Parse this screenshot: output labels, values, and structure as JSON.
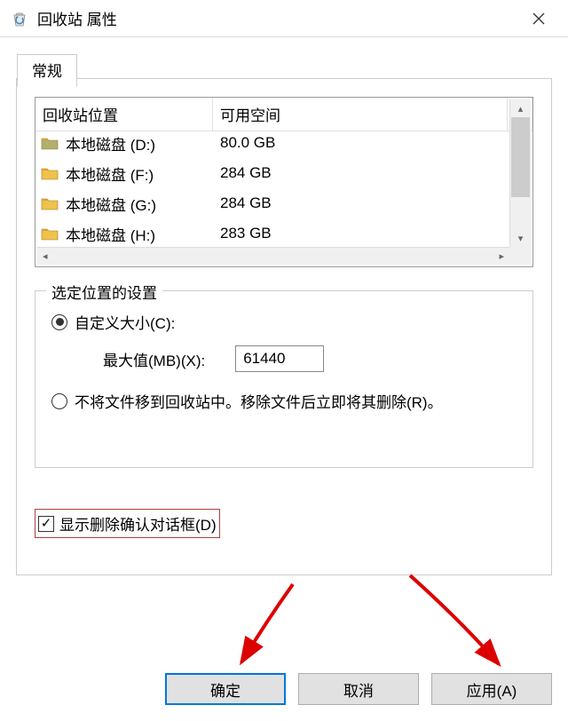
{
  "titlebar": {
    "title": "回收站 属性"
  },
  "tab": {
    "label": "常规"
  },
  "list": {
    "header_location": "回收站位置",
    "header_space": "可用空间",
    "rows": [
      {
        "name": "本地磁盘 (D:)",
        "space": "80.0 GB",
        "folder_color": "#b0b070"
      },
      {
        "name": "本地磁盘 (F:)",
        "space": "284 GB",
        "folder_color": "#f0c24b"
      },
      {
        "name": "本地磁盘 (G:)",
        "space": "284 GB",
        "folder_color": "#f0c24b"
      },
      {
        "name": "本地磁盘 (H:)",
        "space": "283 GB",
        "folder_color": "#f0c24b"
      }
    ]
  },
  "fieldset": {
    "legend": "选定位置的设置",
    "custom_size_label": "自定义大小(C):",
    "max_label": "最大值(MB)(X):",
    "max_value": "61440",
    "no_recycle_label": "不将文件移到回收站中。移除文件后立即将其删除(R)。"
  },
  "confirm_label": "显示删除确认对话框(D)",
  "buttons": {
    "ok": "确定",
    "cancel": "取消",
    "apply": "应用(A)"
  }
}
